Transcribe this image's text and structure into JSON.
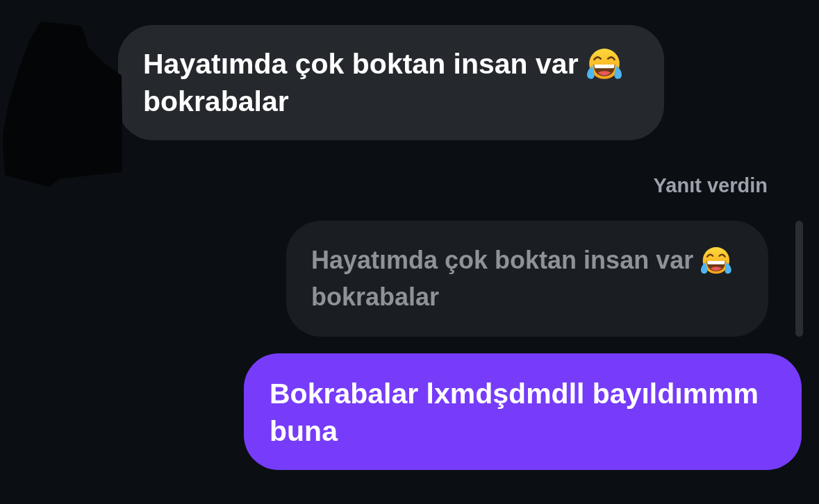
{
  "conversation": {
    "messages": [
      {
        "kind": "received",
        "avatar_obscured": true,
        "parts": [
          {
            "kind": "text",
            "text": "Hayatımda çok boktan insan var"
          },
          {
            "kind": "emoji"
          },
          {
            "kind": "text",
            "text": "bokrabalar"
          }
        ]
      },
      {
        "kind": "sent",
        "reply": {
          "label": "Yanıt verdin",
          "quote": [
            {
              "kind": "text",
              "text": "Hayatımda çok boktan insan var"
            },
            {
              "kind": "emoji"
            },
            {
              "kind": "text",
              "text": "bokrabalar"
            }
          ]
        },
        "parts": [
          {
            "kind": "text",
            "text": "Bokrabalar lxmdşdmdll bayıldımmm buna"
          }
        ]
      }
    ]
  }
}
